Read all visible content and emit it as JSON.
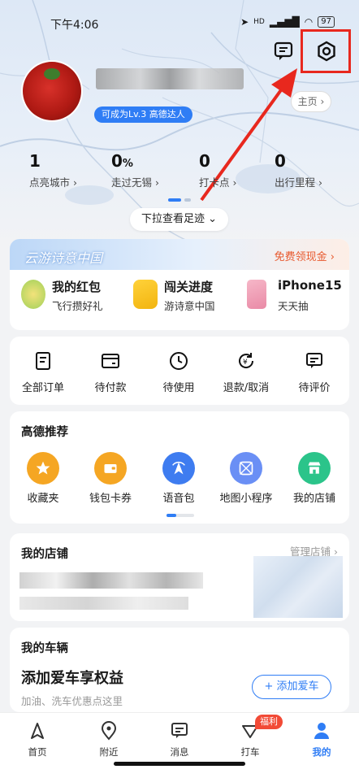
{
  "status_bar": {
    "time": "下午4:06",
    "signal": "HD",
    "battery": "97"
  },
  "profile": {
    "level_badge": "可成为Lv.3 高德达人",
    "home_button": "主页",
    "stats": [
      {
        "value": "1",
        "unit": "",
        "label": "点亮城市"
      },
      {
        "value": "0",
        "unit": "%",
        "label": "走过无锡"
      },
      {
        "value": "0",
        "unit": "",
        "label": "打卡点"
      },
      {
        "value": "0",
        "unit": "",
        "label": "出行里程"
      }
    ],
    "pull_hint": "下拉查看足迹"
  },
  "promo": {
    "banner_title": "云游诗意中国",
    "banner_link": "免费领现金",
    "items": [
      {
        "title": "我的红包",
        "subtitle": "飞行攒好礼"
      },
      {
        "title": "闯关进度",
        "subtitle": "游诗意中国"
      },
      {
        "title": "iPhone15",
        "subtitle": "天天抽"
      }
    ]
  },
  "orders": {
    "items": [
      {
        "label": "全部订单",
        "icon": "order-list-icon"
      },
      {
        "label": "待付款",
        "icon": "wallet-card-icon"
      },
      {
        "label": "待使用",
        "icon": "clock-icon"
      },
      {
        "label": "退款/取消",
        "icon": "refund-icon"
      },
      {
        "label": "待评价",
        "icon": "comment-icon"
      }
    ]
  },
  "recommend": {
    "title": "高德推荐",
    "items": [
      {
        "label": "收藏夹",
        "icon": "star-icon",
        "color": "#f5a623"
      },
      {
        "label": "钱包卡券",
        "icon": "wallet-icon",
        "color": "#f5a623"
      },
      {
        "label": "语音包",
        "icon": "voice-navigation-icon",
        "color": "#3e7cf0"
      },
      {
        "label": "地图小程序",
        "icon": "map-app-icon",
        "color": "#3e7cf0"
      },
      {
        "label": "我的店铺",
        "icon": "shop-icon",
        "color": "#2bc48a"
      }
    ]
  },
  "shop": {
    "title": "我的店铺",
    "manage": "管理店铺"
  },
  "vehicle": {
    "title": "我的车辆",
    "headline": "添加爱车享权益",
    "subtitle": "加油、洗车优惠点这里",
    "add_button": "+ 添加爱车"
  },
  "tabbar": {
    "items": [
      {
        "label": "首页",
        "icon": "navigation-arrow-icon"
      },
      {
        "label": "附近",
        "icon": "location-pin-icon"
      },
      {
        "label": "消息",
        "icon": "message-icon"
      },
      {
        "label": "打车",
        "icon": "taxi-icon"
      },
      {
        "label": "我的",
        "icon": "user-icon"
      }
    ],
    "taxi_badge": "福利",
    "active_color": "#2f7df5"
  },
  "colors": {
    "accent": "#2f7df5",
    "annotation_red": "#e8281e",
    "promo_orange": "#e8592e"
  }
}
